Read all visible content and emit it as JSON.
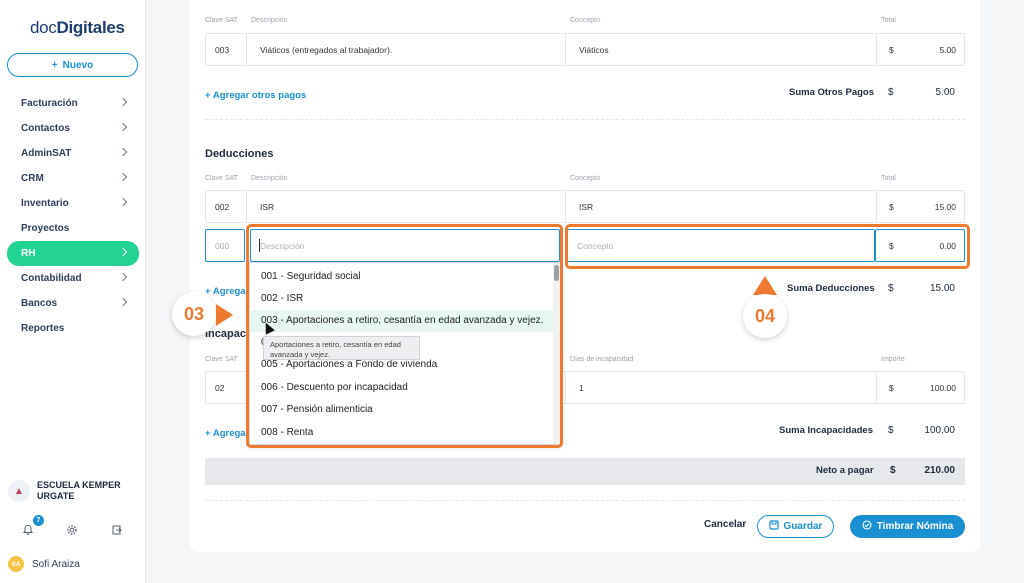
{
  "sidebar": {
    "logo_prefix": "doc",
    "logo_suffix": "Digitales",
    "new_button": "Nuevo",
    "items": [
      {
        "label": "Facturación"
      },
      {
        "label": "Contactos"
      },
      {
        "label": "AdminSAT"
      },
      {
        "label": "CRM"
      },
      {
        "label": "Inventario"
      },
      {
        "label": "Proyectos"
      },
      {
        "label": "RH"
      },
      {
        "label": "Contabilidad"
      },
      {
        "label": "Bancos"
      },
      {
        "label": "Reportes"
      }
    ],
    "org_name": "ESCUELA KEMPER URGATE",
    "notification_count": "7",
    "user_initials": "SA",
    "user_name": "Sofi Araiza"
  },
  "otros_pagos": {
    "headers": {
      "clave": "Clave SAT",
      "descripcion": "Descripción",
      "concepto": "Concepto",
      "total": "Total"
    },
    "row": {
      "clave": "003",
      "descripcion": "Viáticos (entregados al trabajador).",
      "concepto": "Viáticos",
      "currency": "$",
      "total": "5.00"
    },
    "add_link": "+ Agregar otros pagos",
    "sum_label": "Suma Otros Pagos",
    "sum_currency": "$",
    "sum_value": "5.00"
  },
  "deducciones": {
    "title": "Deducciones",
    "headers": {
      "clave": "Clave SAT",
      "descripcion": "Descripción",
      "concepto": "Concepto",
      "total": "Total"
    },
    "row": {
      "clave": "002",
      "descripcion": "ISR",
      "concepto": "ISR",
      "currency": "$",
      "total": "15.00"
    },
    "new_row": {
      "clave_placeholder": "000",
      "descripcion_placeholder": "Descripción",
      "concepto_placeholder": "Concepto",
      "currency": "$",
      "total": "0.00"
    },
    "add_link_partial": "+ Agrega",
    "sum_label": "Suma Deducciones",
    "sum_currency": "$",
    "sum_value": "15.00"
  },
  "incapacidades": {
    "title_partial": "Incapacid",
    "headers": {
      "clave": "Clave SAT",
      "dias": "Días de incapacidad",
      "importe": "Importe"
    },
    "row": {
      "clave": "02",
      "dias": "1",
      "currency": "$",
      "importe": "100.00"
    },
    "add_link_partial": "+ Agrega",
    "sum_label": "Suma Incapacidades",
    "sum_currency": "$",
    "sum_value": "100.00"
  },
  "neto": {
    "label": "Neto a pagar",
    "currency": "$",
    "value": "210.00"
  },
  "actions": {
    "cancel": "Cancelar",
    "save": "Guardar",
    "stamp": "Timbrar Nómina"
  },
  "dropdown": {
    "options": [
      "001 - Seguridad social",
      "002 - ISR",
      "003 - Aportaciones a retiro, cesantía en edad avanzada y vejez.",
      "0",
      "005 - Aportaciones a Fondo de vivienda",
      "006 - Descuento por incapacidad",
      "007 - Pensión alimenticia",
      "008 - Renta"
    ],
    "tooltip": "Aportaciones a retiro, cesantía en edad avanzada y vejez."
  },
  "annotations": {
    "step_a": "03",
    "step_b": "04",
    "color": "#ee7a2f"
  }
}
